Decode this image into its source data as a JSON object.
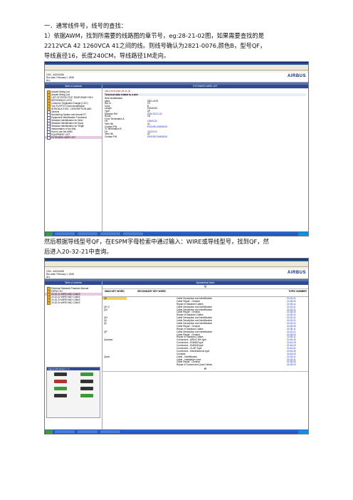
{
  "doc": {
    "line1": "一．通常线件号，线号的查找：",
    "line2": "1）依据AWM，找到所需要的线路图的章节号，eg:28-21-02图，如果需要查找的是",
    "line3": "2212VCA 42 1260VCA 41之间的线。则线号确认为2821-0076,颜色B，型号QF，",
    "line4": "导线直径16，长度240CM，导线路径1M走向。",
    "line5": "然后根据导线型号QF，在ESPM字母检索中通过输入：WIRE或导线型号，找到QF，然",
    "line6": "后进入20-32-21中查询。"
  },
  "shot1": {
    "title": "CSN A320 - Selected effectivity: ALL - Document: AWM - Revision: ...",
    "customer": "CSN - A320/A330",
    "rev": "Rev date: February 1, 2008",
    "eff": "ALL",
    "left_header": "Table of contents",
    "right_header": "EXTENDED WIRE LIST",
    "tree": [
      "Aircraft Wiring List",
      "Aircraft Wiring List",
      "LIST OF EFFECTIVE TEMPORARY REV",
      "REFERENCE LISTS",
      "Customer Originated Change (COC)",
      "Tool FLR/FTR Chart Identification",
      "INTRODUCTION - DESCRIPTION AND",
      "General",
      "Numbering System and Aircraft ST",
      "Equipment Identification Functional",
      "Standard Identification for Wire/",
      "Standard Identification for Equip",
      "Standard Identification for Single",
      "Interpretation of the AWL",
      "How to use the AWM",
      "EQUIPMENT LIST",
      "EXTENDED WIRE LIST"
    ],
    "wire_ref": "2821-0076 AWL 28-21-02",
    "section_title": "Technical data related to a wire",
    "kv": [
      [
        "Wire identification",
        ""
      ],
      [
        "Ident",
        "2821-0076"
      ],
      [
        "Ref Ct",
        "15"
      ],
      [
        "Color",
        "B"
      ],
      [
        "Length",
        "00240CM"
      ],
      [
        "Type",
        "QF"
      ],
      [
        "Diagram Ref",
        "ASM 28-21-02"
      ],
      [
        "Route",
        "1M"
      ],
      [
        "From Termination A",
        ""
      ],
      [
        "Fin",
        "1260VCA"
      ],
      [
        "Term Nb",
        "41"
      ],
      [
        "Contact P/N",
        "EN3155-016M1818"
      ],
      [
        "To Termination B",
        ""
      ],
      [
        "Fin",
        "2212VCA"
      ],
      [
        "Term Nb",
        "42"
      ],
      [
        "Contact P/N",
        "EN3155-016M1818"
      ]
    ],
    "taskbar": [
      "开始",
      "AWM 2821",
      "ESPM",
      "Microsoft Word",
      "Outlook"
    ]
  },
  "shot2": {
    "title": "CSN A320 - Selected effectivity: ALL - Document: ESPM - Revision: ...",
    "customer": "CSN - A320/A330",
    "rev": "Rev date: February 1, 2008",
    "eff": "ALL",
    "left_header": "Table of contents",
    "right_header": "Alphabetical Index",
    "tree": [
      "Electrical Standard Practices Manual",
      "ESPM TOC",
      "20-32-21 WIRE AND CABLE",
      "20-32-22 WIRE AND CABLE",
      "20-32-23 WIRE AND CABLE",
      "20-32-24 WIRE AND CABLE"
    ],
    "figure_title": "Figure 001 Sheet 1 / 2",
    "col_main": "MAIN KEY WORD",
    "col_secondary": "SECONDARY KEY WORD",
    "col_topic": "TOPIC NUMBER",
    "letter_q": "Q",
    "letter_r": "R",
    "rows": [
      [
        "QF",
        "",
        "Cable Description and Identification",
        "20-32-21"
      ],
      [
        "",
        "",
        "Cable Repair - General",
        "20-35-00"
      ],
      [
        "",
        "",
        "Repair of Standard Cables",
        "20-35-11"
      ],
      [
        "QF-G",
        "",
        "Cable Description and Identification",
        "20-32-21"
      ],
      [
        "QG",
        "",
        "Cable Description and Identification",
        "20-32-21"
      ],
      [
        "",
        "",
        "Cable Repair - General",
        "20-35-00"
      ],
      [
        "",
        "",
        "Repair of Standard Cables",
        "20-35-11"
      ],
      [
        "QH",
        "",
        "Cable Description and Identification",
        "20-32-21"
      ],
      [
        "QJ",
        "",
        "Cable Description and Identification",
        "20-32-21"
      ],
      [
        "QL",
        "",
        "Cable Description and Identification",
        "20-32-21"
      ],
      [
        "",
        "",
        "Cable Repair - General",
        "20-35-00"
      ],
      [
        "",
        "",
        "Repair of Standard Cables",
        "20-35-11"
      ],
      [
        "QP",
        "",
        "Cable Description and Identification",
        "20-32-21"
      ],
      [
        "",
        "",
        "Cable Repair - General",
        "20-35-00"
      ],
      [
        "",
        "",
        "Repair of Standard Cables",
        "20-35-11"
      ],
      [
        "Quadrax",
        "",
        "Connectors - ARINC 600 type",
        "20-44-30"
      ],
      [
        "",
        "",
        "Connectors - EN3682 type",
        "20-44-19"
      ],
      [
        "",
        "",
        "Connectors - EN3545 type",
        "20-44-24"
      ],
      [
        "",
        "",
        "Connectors - CLAR Type",
        "20-44-31"
      ],
      [
        "",
        "",
        "Connectors - Miscellaneous type",
        "20-44-40"
      ],
      [
        "",
        "",
        "Contacts",
        "20-46-00"
      ],
      [
        "Quad",
        "",
        "Cable - Identification",
        "20-32-21"
      ],
      [
        "",
        "",
        "Cable - Installation rules",
        "20-33-11"
      ],
      [
        "",
        "",
        "Cable Repair - General",
        "20-35-00"
      ],
      [
        "",
        "",
        "Repair of Coaxial and Quad Cables",
        "20-35-20"
      ]
    ],
    "taskbar": [
      "开始",
      "ESPM",
      "Microsoft Word",
      "PowerPoint"
    ]
  },
  "colors": {
    "highlight": "#f7d14a",
    "header_blue": "#2f4a8f",
    "link_blue": "#1a2fb0"
  }
}
